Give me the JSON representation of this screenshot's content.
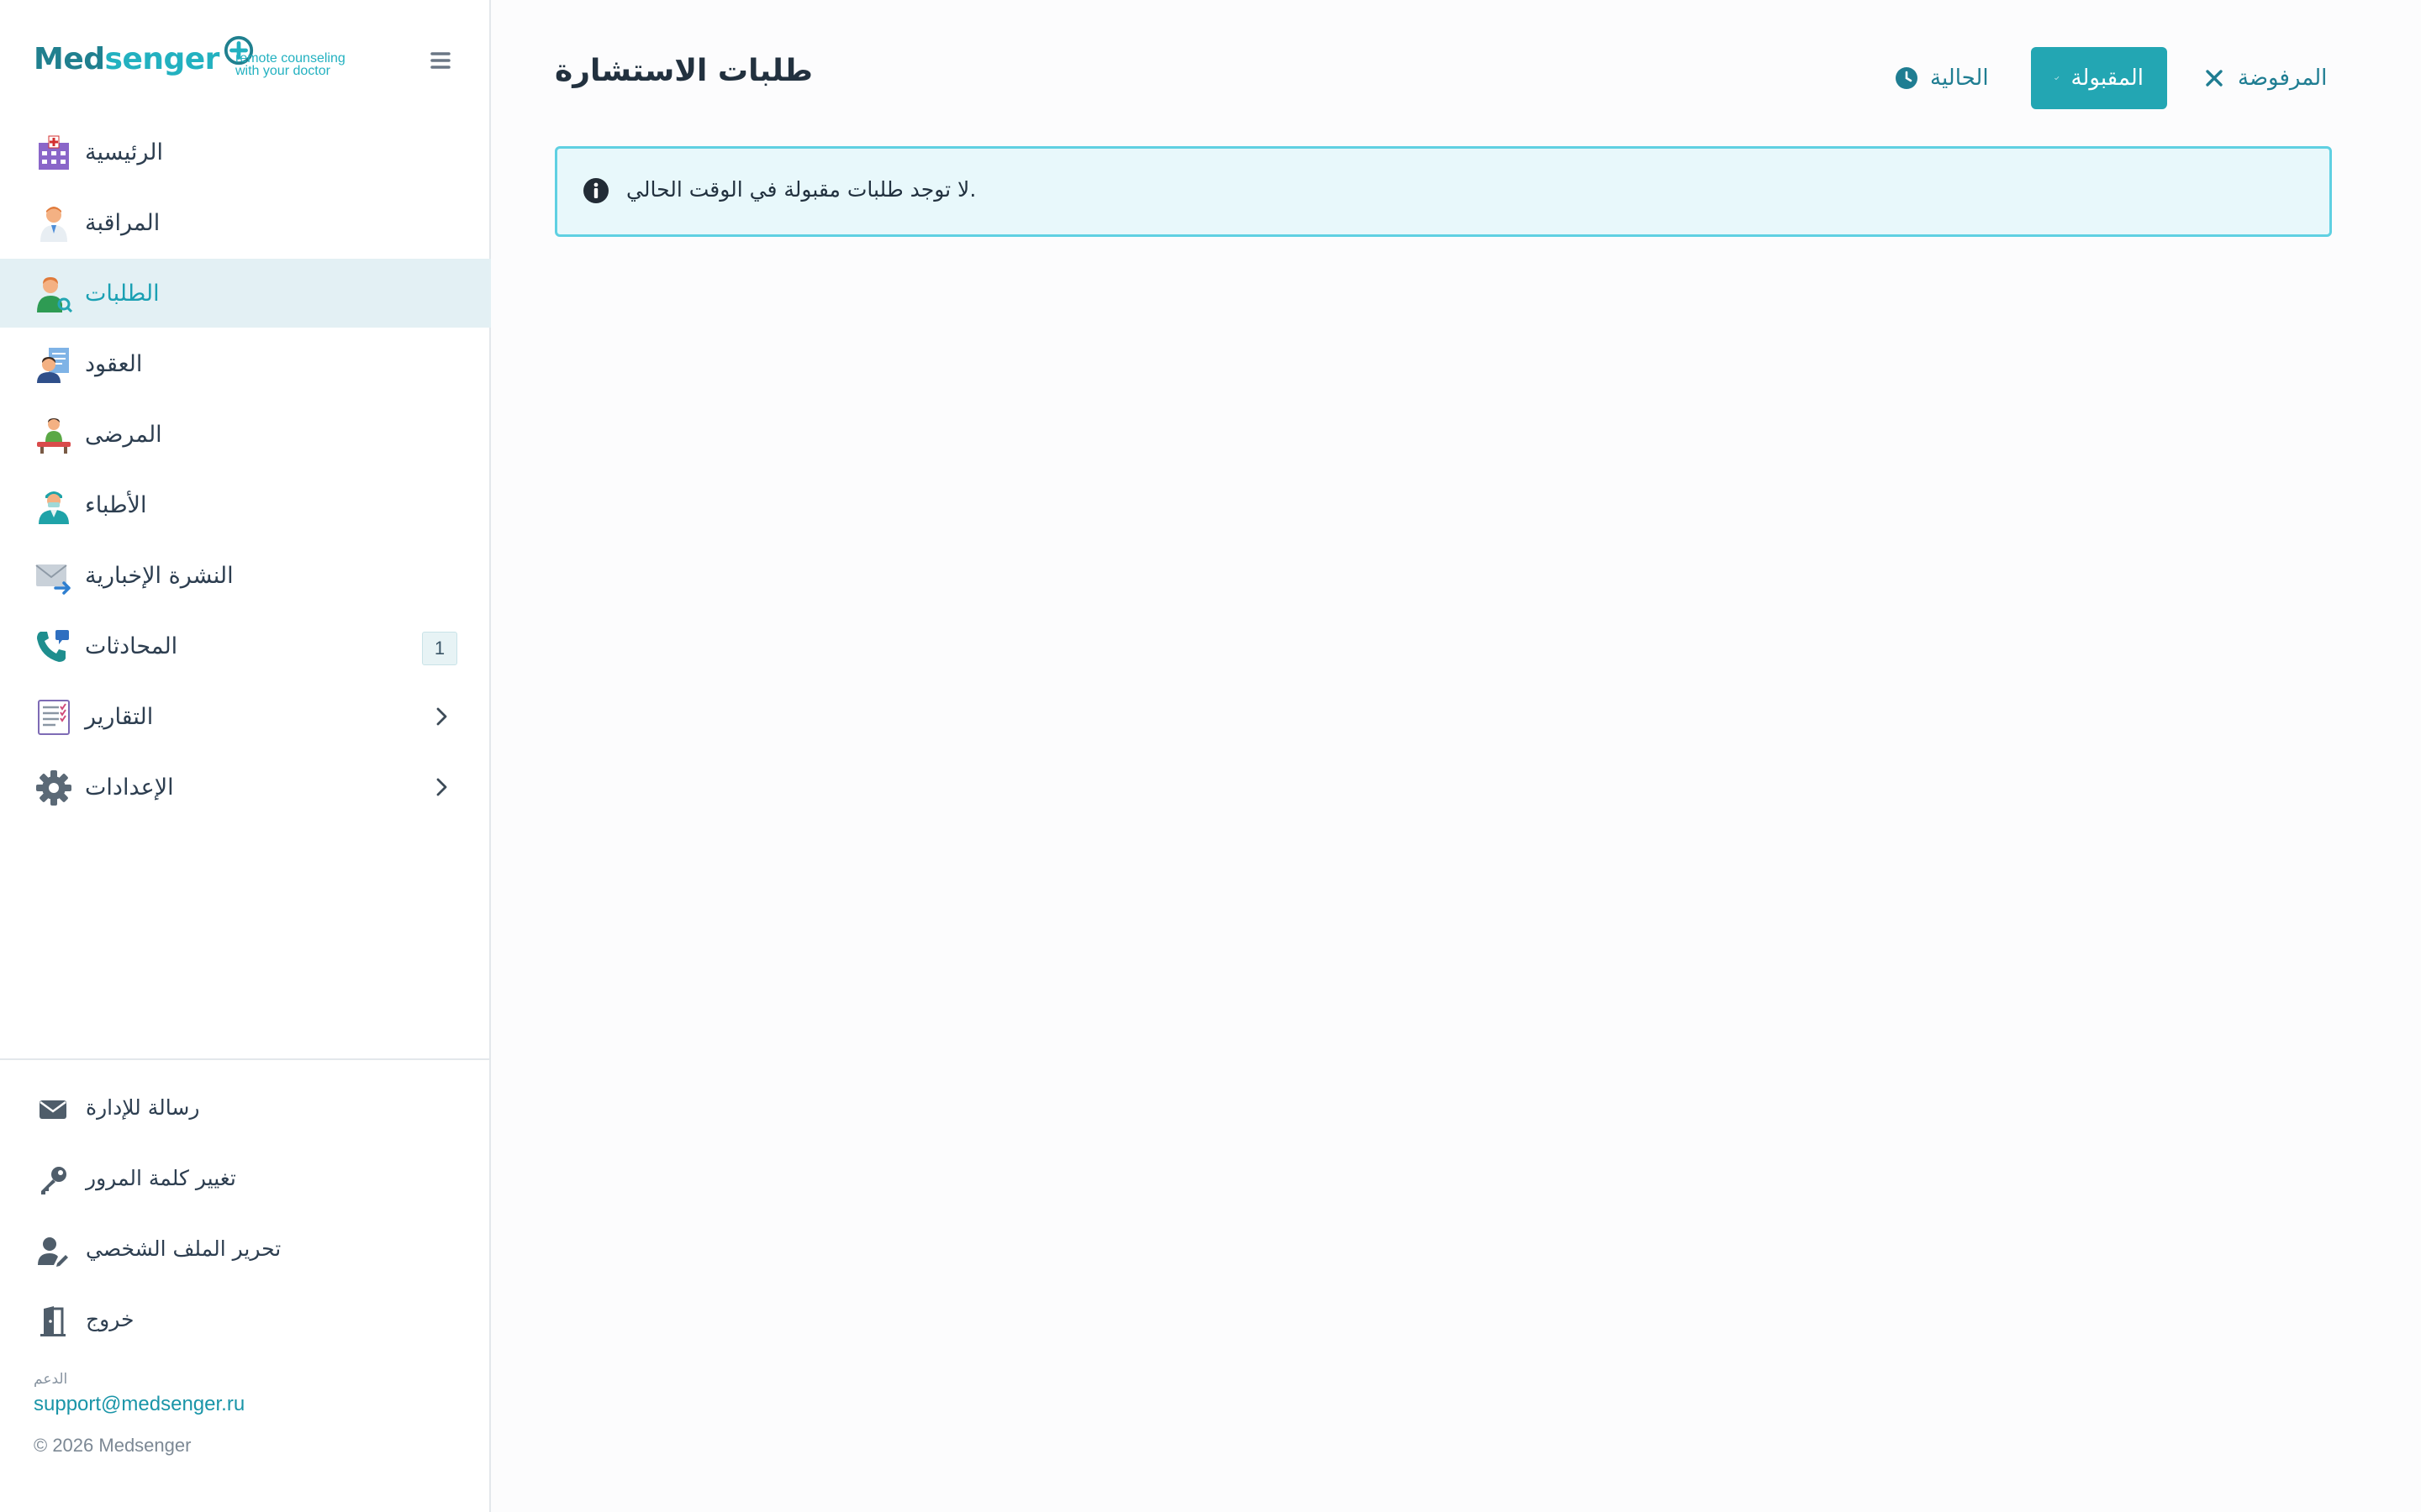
{
  "brand": {
    "word_a": "Med",
    "word_b": "senger",
    "tagline_1": "remote counseling",
    "tagline_2": "with your doctor"
  },
  "sidebar": {
    "items": [
      {
        "label": "الرئيسية",
        "icon": "hospital-icon"
      },
      {
        "label": "المراقبة",
        "icon": "doctor-icon"
      },
      {
        "label": "الطلبات",
        "icon": "user-search-icon",
        "active": true
      },
      {
        "label": "العقود",
        "icon": "contract-icon"
      },
      {
        "label": "المرضى",
        "icon": "patient-icon"
      },
      {
        "label": "الأطباء",
        "icon": "medic-icon"
      },
      {
        "label": "النشرة الإخبارية",
        "icon": "envelope-send-icon"
      },
      {
        "label": "المحادثات",
        "icon": "phone-icon",
        "badge": "1"
      },
      {
        "label": "التقارير",
        "icon": "report-icon",
        "expandable": true
      },
      {
        "label": "الإعدادات",
        "icon": "gear-icon",
        "expandable": true
      }
    ],
    "bottom_links": [
      {
        "label": "رسالة للإدارة",
        "icon": "envelope-icon"
      },
      {
        "label": "تغيير كلمة المرور",
        "icon": "key-icon"
      },
      {
        "label": "تحرير الملف الشخصي",
        "icon": "user-edit-icon"
      },
      {
        "label": "خروج",
        "icon": "door-exit-icon"
      }
    ],
    "support_caption": "الدعم",
    "support_email": "support@medsenger.ru",
    "copyright": "© 2026 Medsenger"
  },
  "main": {
    "title": "طلبات الاستشارة",
    "tabs": {
      "current": "الحالية",
      "accepted": "المقبولة",
      "rejected": "المرفوضة"
    },
    "alert_text": "لا توجد طلبات مقبولة في الوقت الحالي."
  },
  "colors": {
    "accent": "#23a6b3",
    "active_row": "#e3f0f4",
    "alert_bg": "#e8f8fb",
    "alert_border": "#5fd0e2"
  }
}
